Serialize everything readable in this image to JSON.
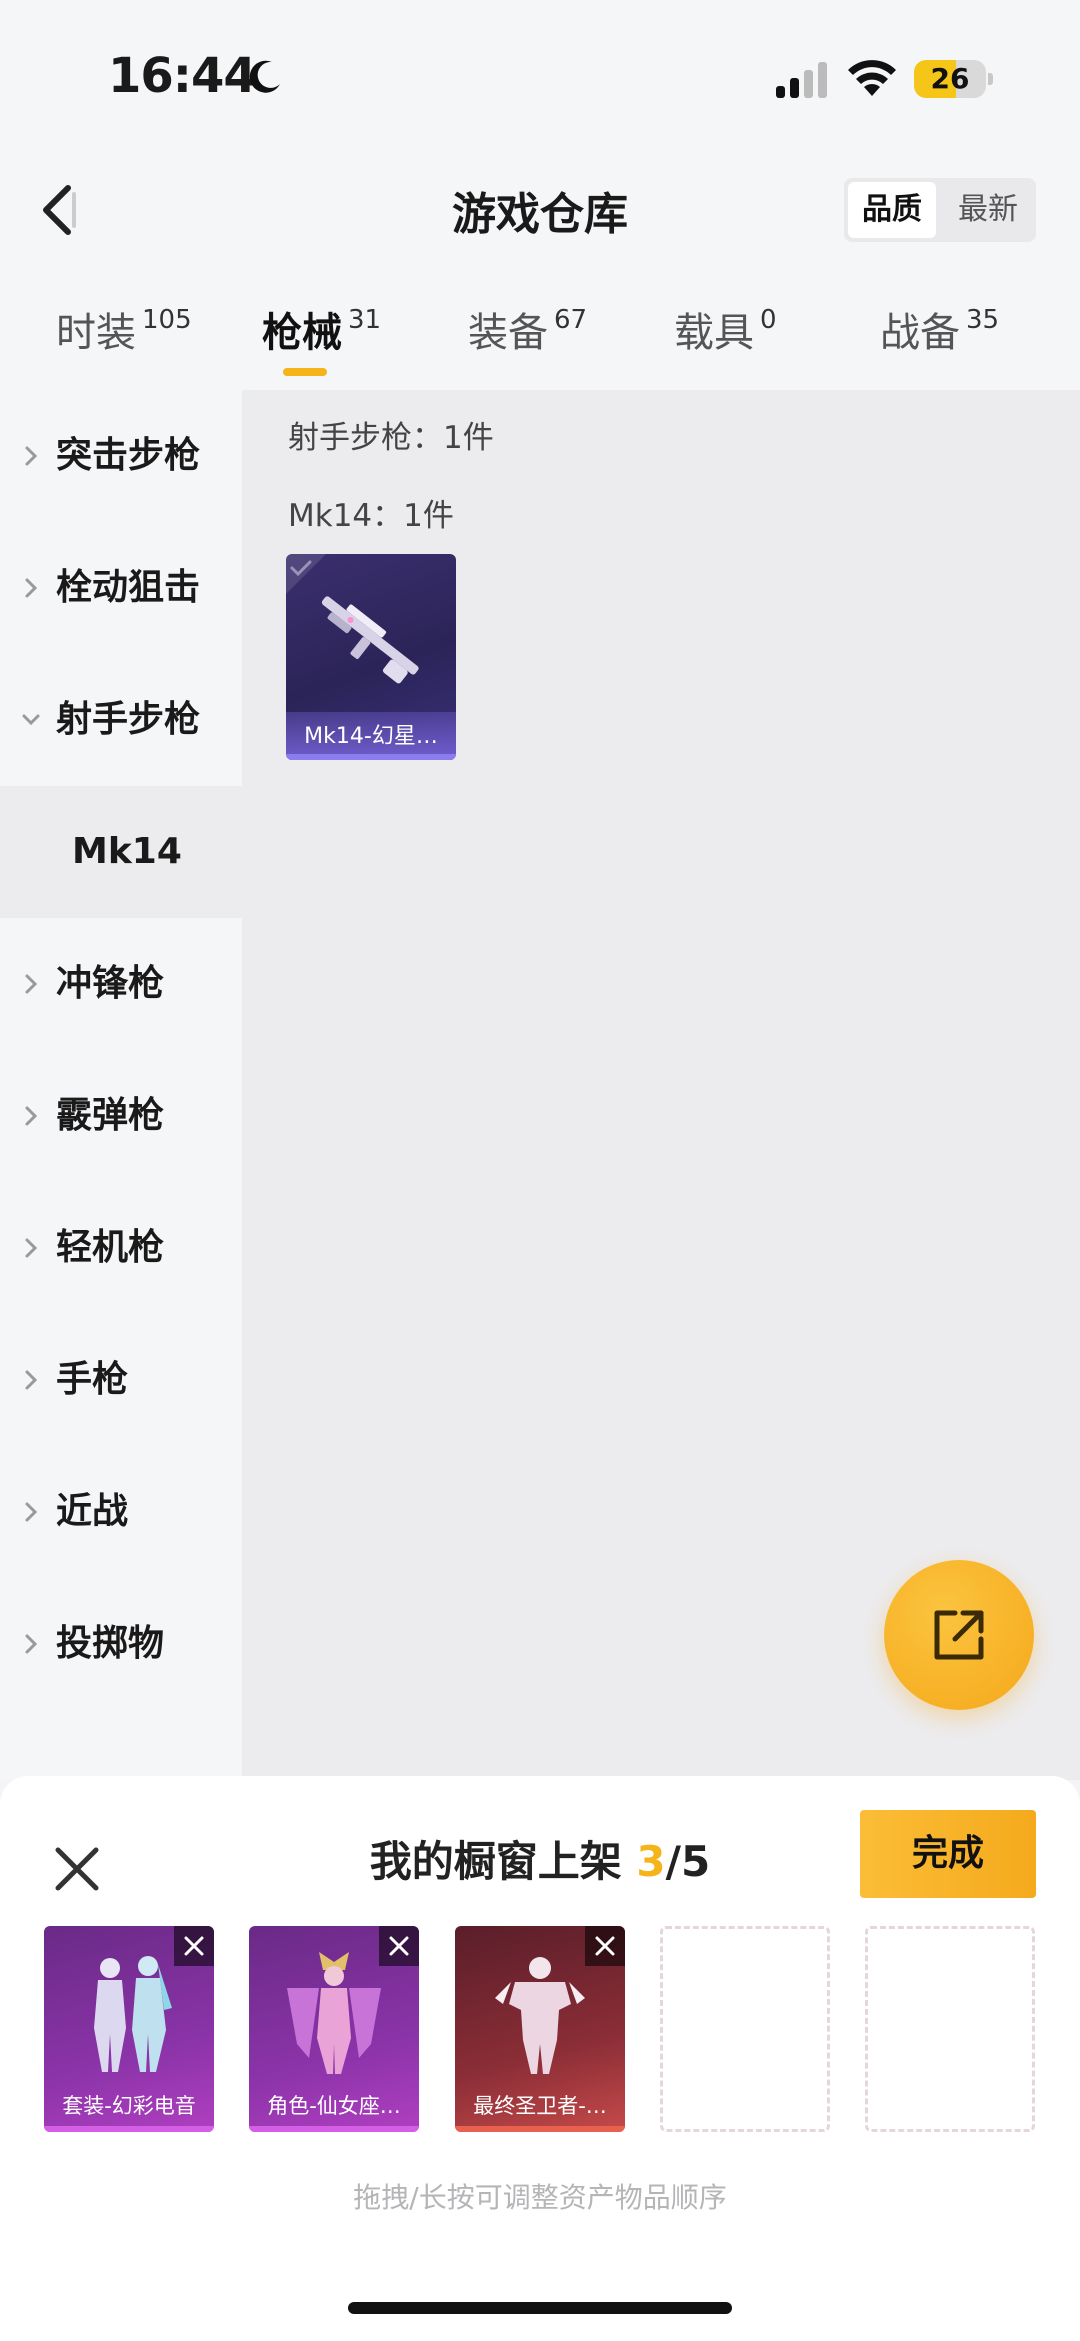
{
  "status": {
    "time": "16:44",
    "battery": "26",
    "battery_level": 0.26
  },
  "header": {
    "title": "游戏仓库",
    "sort_options": [
      "品质",
      "最新"
    ],
    "sort_selected": "品质"
  },
  "tabs": [
    {
      "label": "时装",
      "count": "105"
    },
    {
      "label": "枪械",
      "count": "31",
      "active": true
    },
    {
      "label": "装备",
      "count": "67"
    },
    {
      "label": "载具",
      "count": "0"
    },
    {
      "label": "战备",
      "count": "35"
    }
  ],
  "sidebar": {
    "items": [
      {
        "label": "突击步枪"
      },
      {
        "label": "栓动狙击"
      },
      {
        "label": "射手步枪",
        "expanded": true
      },
      {
        "label": "Mk14",
        "selected": true
      },
      {
        "label": "冲锋枪"
      },
      {
        "label": "霰弹枪"
      },
      {
        "label": "轻机枪"
      },
      {
        "label": "手枪"
      },
      {
        "label": "近战"
      },
      {
        "label": "投掷物"
      }
    ]
  },
  "content": {
    "category_count": "射手步枪：1件",
    "sub_count": "Mk14：1件",
    "items": [
      {
        "name": "Mk14-幻星…"
      }
    ]
  },
  "sheet": {
    "title_prefix": "我的橱窗上架 ",
    "filled": "3",
    "title_suffix": "/5",
    "done_label": "完成",
    "slots": [
      {
        "name": "套装-幻彩电音"
      },
      {
        "name": "角色-仙女座…"
      },
      {
        "name": "最终圣卫者-…"
      }
    ],
    "hint": "拖拽/长按可调整资产物品顺序"
  },
  "colors": {
    "accent": "#f5b41a",
    "epic_purple": "#3b2f6e",
    "legend_pink": "#b03fc0",
    "mythic_red": "#c54a4a"
  }
}
